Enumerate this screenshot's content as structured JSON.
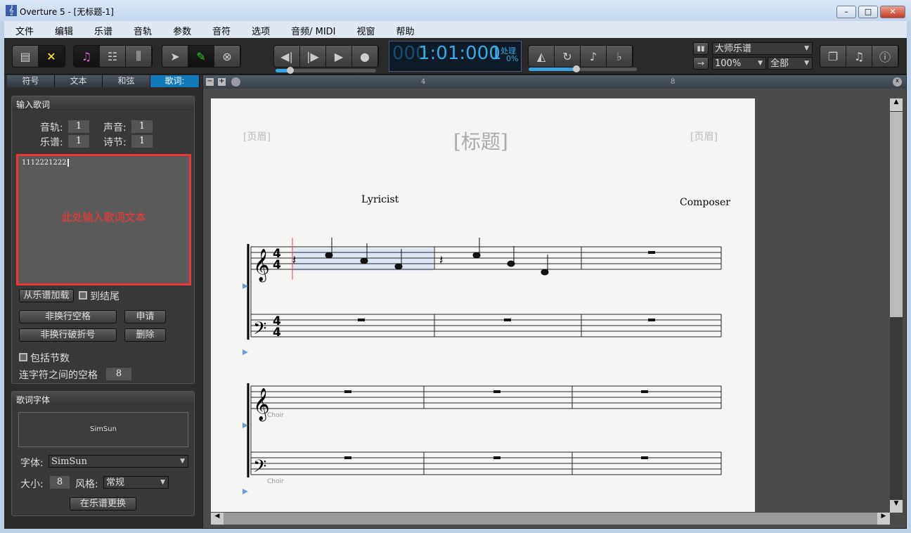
{
  "window": {
    "title": "Overture 5 - [无标题-1]",
    "minimize": "–",
    "maximize": "□",
    "close": "✕"
  },
  "menu": [
    "文件",
    "编辑",
    "乐谱",
    "音轨",
    "参数",
    "音符",
    "选项",
    "音频/ MIDI",
    "视窗",
    "帮助"
  ],
  "counter": {
    "dim_prefix": "000",
    "time": "1:01:000",
    "value": "1",
    "status": "处理",
    "percent": "0%"
  },
  "view": {
    "score_type": "大师乐谱",
    "zoom": "100%",
    "scope": "全部"
  },
  "tabs": [
    {
      "label": "符号"
    },
    {
      "label": "文本"
    },
    {
      "label": "和弦"
    },
    {
      "label": "歌词:",
      "selected": true
    }
  ],
  "lyrics_input": {
    "header": "输入歌词",
    "track_label": "音轨:",
    "track_value": "1",
    "voice_label": "声音:",
    "voice_value": "1",
    "staff_label": "乐谱:",
    "staff_value": "1",
    "verse_label": "诗节:",
    "verse_value": "1",
    "text_value": "1112221222",
    "annotation": "此处输入歌词文本",
    "load_button": "从乐谱加载",
    "to_end_label": "到结尾",
    "nbsp_button": "非换行空格",
    "apply_button": "申请",
    "nb_hyphen_button": "非换行破折号",
    "delete_button": "删除",
    "include_measures_label": "包括节数",
    "hyphen_spacing_label": "连字符之间的空格",
    "hyphen_spacing_value": "8"
  },
  "lyrics_font": {
    "header": "歌词字体",
    "preview": "SimSun",
    "font_label": "字体:",
    "font_value": "SimSun",
    "size_label": "大小:",
    "size_value": "8",
    "style_label": "风格:",
    "style_value": "常规",
    "replace_button": "在乐谱更换"
  },
  "ruler": {
    "marks": [
      "4",
      "8"
    ]
  },
  "score": {
    "header_left": "[页眉]",
    "title": "[标题]",
    "header_right": "[页眉]",
    "lyricist": "Lyricist",
    "composer": "Composer",
    "time_sig": "4",
    "staff_label": "Choir"
  },
  "colors": {
    "accent": "#1279b8",
    "annotation": "#ff3333",
    "selection": "#dde6f4"
  }
}
